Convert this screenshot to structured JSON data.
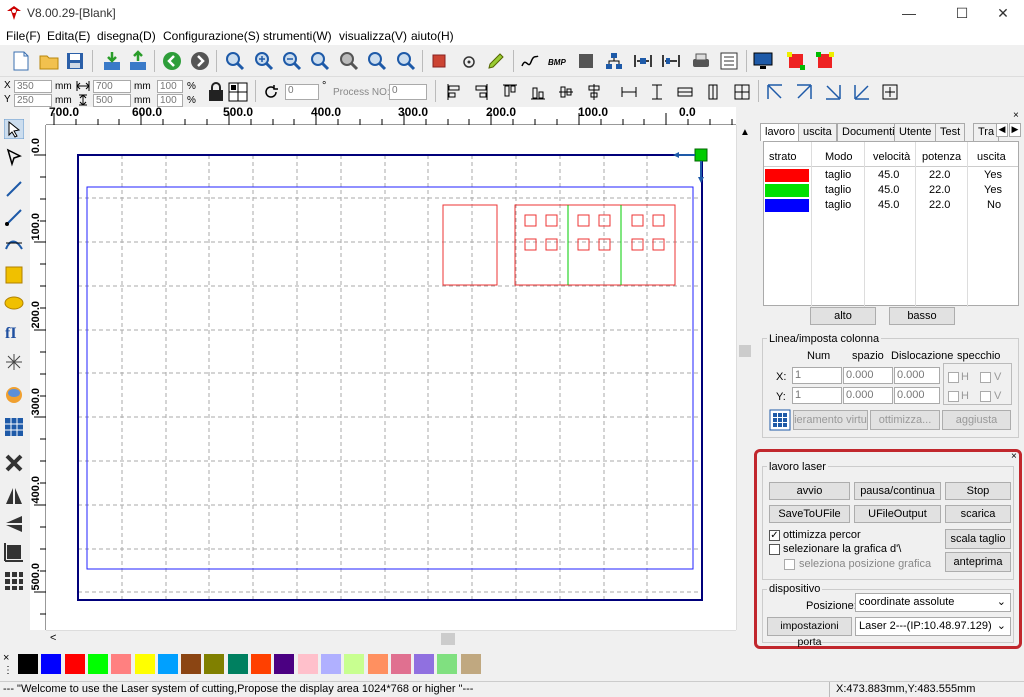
{
  "window": {
    "title": "V8.00.29-[Blank]"
  },
  "menu": [
    "File(F)",
    "Edita(E)",
    "disegna(D)",
    "Configurazione(S)",
    "strumenti(W)",
    "visualizza(V)",
    "aiuto(H)"
  ],
  "coords": {
    "x_value": "350",
    "y_value": "250",
    "unit": "mm",
    "w_value": "700",
    "h_value": "500",
    "w_pct": "100",
    "h_pct": "100",
    "pct_sign": "%",
    "rotate_value": "0",
    "degree": "°",
    "process_label": "Process NO:",
    "process_value": "0"
  },
  "ruler": {
    "h_labels": [
      "700.0",
      "600.0",
      "500.0",
      "400.0",
      "300.0",
      "200.0",
      "100.0",
      "0.0"
    ],
    "v_labels": [
      "0.0",
      "100.0",
      "200.0",
      "300.0",
      "400.0",
      "500.0"
    ]
  },
  "tabs": [
    "lavoro",
    "uscita",
    "Documenti",
    "Utente",
    "Test",
    "Tra"
  ],
  "layers": {
    "headers": [
      "strato",
      "Modo",
      "velocità",
      "potenza",
      "uscita"
    ],
    "rows": [
      {
        "color": "#ff0000",
        "mode": "taglio",
        "speed": "45.0",
        "power": "22.0",
        "output": "Yes"
      },
      {
        "color": "#00e000",
        "mode": "taglio",
        "speed": "45.0",
        "power": "22.0",
        "output": "Yes"
      },
      {
        "color": "#0000ff",
        "mode": "taglio",
        "speed": "45.0",
        "power": "22.0",
        "output": "No"
      }
    ],
    "up_label": "alto",
    "down_label": "basso"
  },
  "array": {
    "group_label": "Linea/imposta colonna",
    "col_num": "Num",
    "col_space": "spazio",
    "col_disloc": "Dislocazione",
    "col_mirror": "specchio",
    "x_label": "X:",
    "y_label": "Y:",
    "x_num": "1",
    "x_space": "0.000",
    "x_disloc": "0.000",
    "y_num": "1",
    "y_space": "0.000",
    "y_disloc": "0.000",
    "h_label": "H",
    "v_label": "V",
    "btn_virtual": "ieramento virtu",
    "btn_optimize": "ottimizza...",
    "btn_adjust": "aggiusta"
  },
  "laser": {
    "group_label": "lavoro laser",
    "start": "avvio",
    "pause": "pausa/continua",
    "stop": "Stop",
    "save_file": "SaveToUFile",
    "ufile_output": "UFileOutput",
    "download": "scarica",
    "opt_path": "ottimizza percor",
    "opt_path_checked": true,
    "select_graphic": "selezionare la grafica d'\\",
    "select_position": "seleziona posizione grafica",
    "scale_cut": "scala taglio",
    "preview": "anteprima",
    "device_label": "dispositivo",
    "position_label": "Posizione:",
    "position_value": "coordinate assolute",
    "port_settings": "impostazioni porta",
    "device_value": "Laser 2---(IP:10.48.97.129)"
  },
  "palette": [
    "#000000",
    "#0000ff",
    "#ff0000",
    "#00ff00",
    "#ff8080",
    "#ffff00",
    "#00a0ff",
    "#8b4513",
    "#808000",
    "#008060",
    "#ff4000",
    "#4b0082",
    "#ffc0cb",
    "#b0b0ff",
    "#c8ff90",
    "#ff9060",
    "#e07090",
    "#9070e0",
    "#80e080",
    "#c0a880"
  ],
  "palette_close": "×",
  "status": {
    "message": "--- \"Welcome to use the Laser system of cutting,Propose the display area 1024*768 or higher \"---",
    "coords": "X:473.883mm,Y:483.555mm"
  },
  "icons": [
    "app-logo-icon",
    "new-file-icon",
    "open-folder-icon",
    "save-icon",
    "import-icon",
    "export-icon",
    "back-icon",
    "forward-icon",
    "zoom-icon"
  ]
}
